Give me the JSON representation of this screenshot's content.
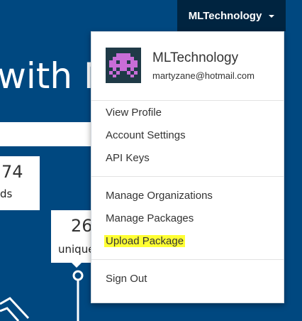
{
  "background": {
    "hero_text": "with N",
    "stat1": {
      "number": "74",
      "label": "ds"
    },
    "stat2": {
      "number": "26",
      "label": "unique"
    }
  },
  "nav": {
    "username": "MLTechnology"
  },
  "dropdown": {
    "profile": {
      "name": "MLTechnology",
      "email": "martyzane@hotmail.com"
    },
    "group1": [
      {
        "label": "View Profile"
      },
      {
        "label": "Account Settings"
      },
      {
        "label": "API Keys"
      }
    ],
    "group2": [
      {
        "label": "Manage Organizations"
      },
      {
        "label": "Manage Packages"
      },
      {
        "label": "Upload Package",
        "highlighted": true
      }
    ],
    "group3": [
      {
        "label": "Sign Out"
      }
    ]
  },
  "colors": {
    "page_bg": "#004880",
    "nav_toggle_bg": "#002440",
    "avatar_bg": "#1f3a47",
    "avatar_fg": "#c86dd7",
    "highlight": "#ffff33"
  }
}
